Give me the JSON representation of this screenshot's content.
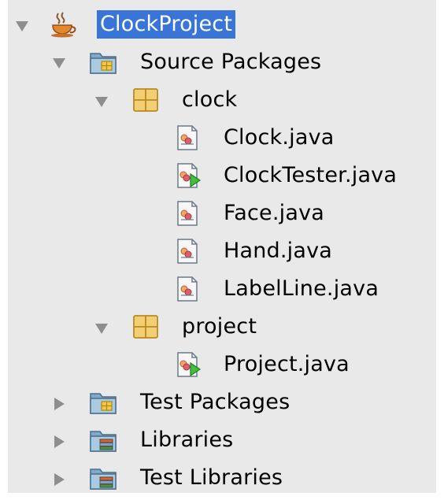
{
  "tree": {
    "project": {
      "label": "ClockProject",
      "selected": true,
      "icon": "coffee-cup-icon",
      "expanded": true
    },
    "source_packages": {
      "label": "Source Packages",
      "icon": "source-folder-icon",
      "expanded": true
    },
    "packages": [
      {
        "label": "clock",
        "icon": "package-icon",
        "expanded": true,
        "files": [
          {
            "label": "Clock.java",
            "icon": "java-file-icon"
          },
          {
            "label": "ClockTester.java",
            "icon": "java-main-file-icon"
          },
          {
            "label": "Face.java",
            "icon": "java-file-icon"
          },
          {
            "label": "Hand.java",
            "icon": "java-file-icon"
          },
          {
            "label": "LabelLine.java",
            "icon": "java-file-icon"
          }
        ]
      },
      {
        "label": "project",
        "icon": "package-icon",
        "expanded": true,
        "files": [
          {
            "label": "Project.java",
            "icon": "java-main-file-icon"
          }
        ]
      }
    ],
    "test_packages": {
      "label": "Test Packages",
      "icon": "test-folder-icon",
      "expanded": false
    },
    "libraries": {
      "label": "Libraries",
      "icon": "library-folder-icon",
      "expanded": false
    },
    "test_libraries": {
      "label": "Test Libraries",
      "icon": "library-folder-icon",
      "expanded": false
    }
  },
  "colors": {
    "panel_background": "#e9e9e9",
    "selection": "#3875d7",
    "selected_text": "#ffffff",
    "disclosure": "#8e8e8e"
  }
}
